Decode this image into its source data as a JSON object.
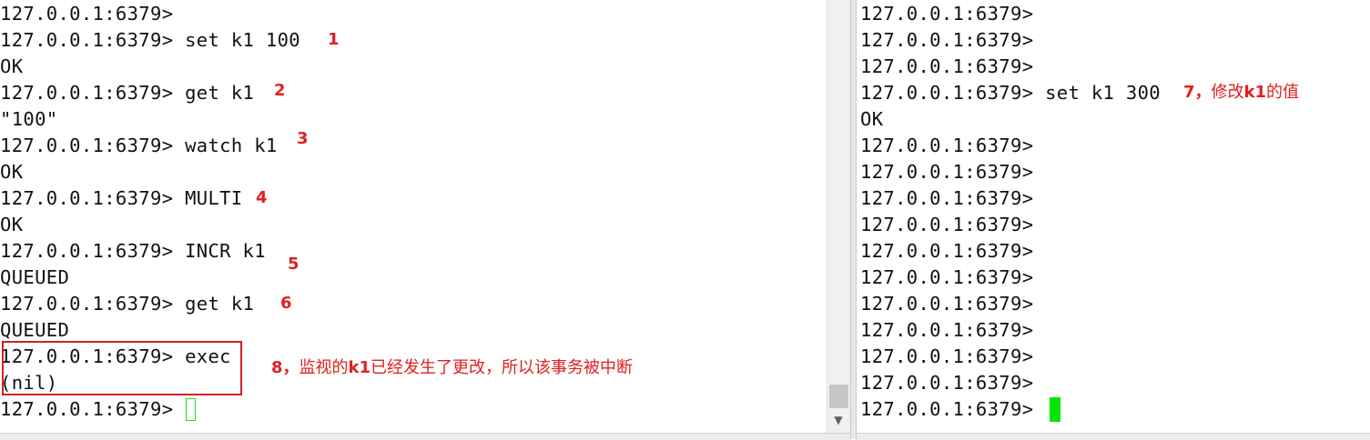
{
  "left_terminal": {
    "lines": [
      "127.0.0.1:6379>",
      "127.0.0.1:6379> set k1 100",
      "OK",
      "127.0.0.1:6379> get k1",
      "\"100\"",
      "127.0.0.1:6379> watch k1",
      "OK",
      "127.0.0.1:6379> MULTI",
      "OK",
      "127.0.0.1:6379> INCR k1",
      "QUEUED",
      "127.0.0.1:6379> get k1",
      "QUEUED",
      "127.0.0.1:6379> exec",
      "(nil)",
      "127.0.0.1:6379> "
    ],
    "annotations": [
      "1",
      "2",
      "3",
      "4",
      "5",
      "6"
    ],
    "note_8_num": "8，",
    "note_8_pre": "监视的",
    "note_8_key": "k1",
    "note_8_post": "已经发生了更改，所以该事务被中断"
  },
  "right_terminal": {
    "lines": [
      "127.0.0.1:6379>",
      "127.0.0.1:6379>",
      "127.0.0.1:6379>",
      "127.0.0.1:6379> set k1 300",
      "OK",
      "127.0.0.1:6379>",
      "127.0.0.1:6379>",
      "127.0.0.1:6379>",
      "127.0.0.1:6379>",
      "127.0.0.1:6379>",
      "127.0.0.1:6379>",
      "127.0.0.1:6379>",
      "127.0.0.1:6379>",
      "127.0.0.1:6379>",
      "127.0.0.1:6379>",
      "127.0.0.1:6379> "
    ],
    "note_7_num": "7，",
    "note_7_pre": "修改",
    "note_7_key": "k1",
    "note_7_post": "的值"
  },
  "scrollbar": {
    "down_arrow_icon": "chevron-down-icon"
  },
  "colors": {
    "annotation": "#e02020",
    "cursor_left": "#2fd62f",
    "cursor_right": "#00e600",
    "highlight_box": "#d42020"
  }
}
